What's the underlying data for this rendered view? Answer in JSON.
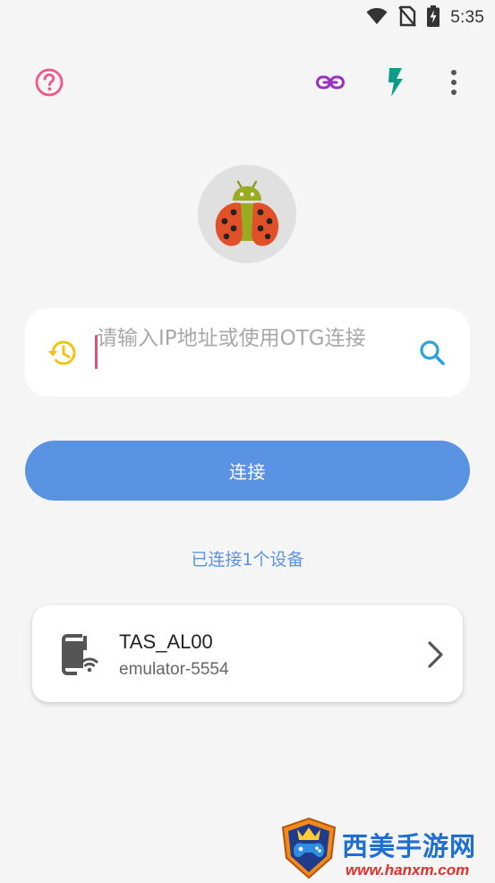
{
  "status_bar": {
    "time": "5:35",
    "icons": [
      "wifi-icon",
      "no-sim-icon",
      "battery-charging-icon"
    ]
  },
  "app_bar": {
    "left_icons": [
      "help-icon"
    ],
    "right_icons": [
      "link-icon",
      "flash-icon",
      "more-vert-icon"
    ],
    "colors": {
      "help": "#f0568a",
      "link": "#9b2fc1",
      "flash": "#0a9e8a",
      "more": "#555555"
    }
  },
  "logo": {
    "icon": "ladybug-android-icon"
  },
  "search": {
    "placeholder": "请输入IP地址或使用OTG连接",
    "history_icon": "history-icon",
    "search_icon": "search-icon",
    "history_color": "#f1c40f",
    "search_color": "#2aa3d8"
  },
  "connect_button": {
    "label": "连接",
    "color": "#5b93e3"
  },
  "connected_status": {
    "text": "已连接1个设备"
  },
  "devices": [
    {
      "name": "TAS_AL00",
      "serial": "emulator-5554",
      "icon": "phone-wifi-icon"
    }
  ],
  "watermark": {
    "title": "西美手游网",
    "url": "www.hanxm.com"
  }
}
